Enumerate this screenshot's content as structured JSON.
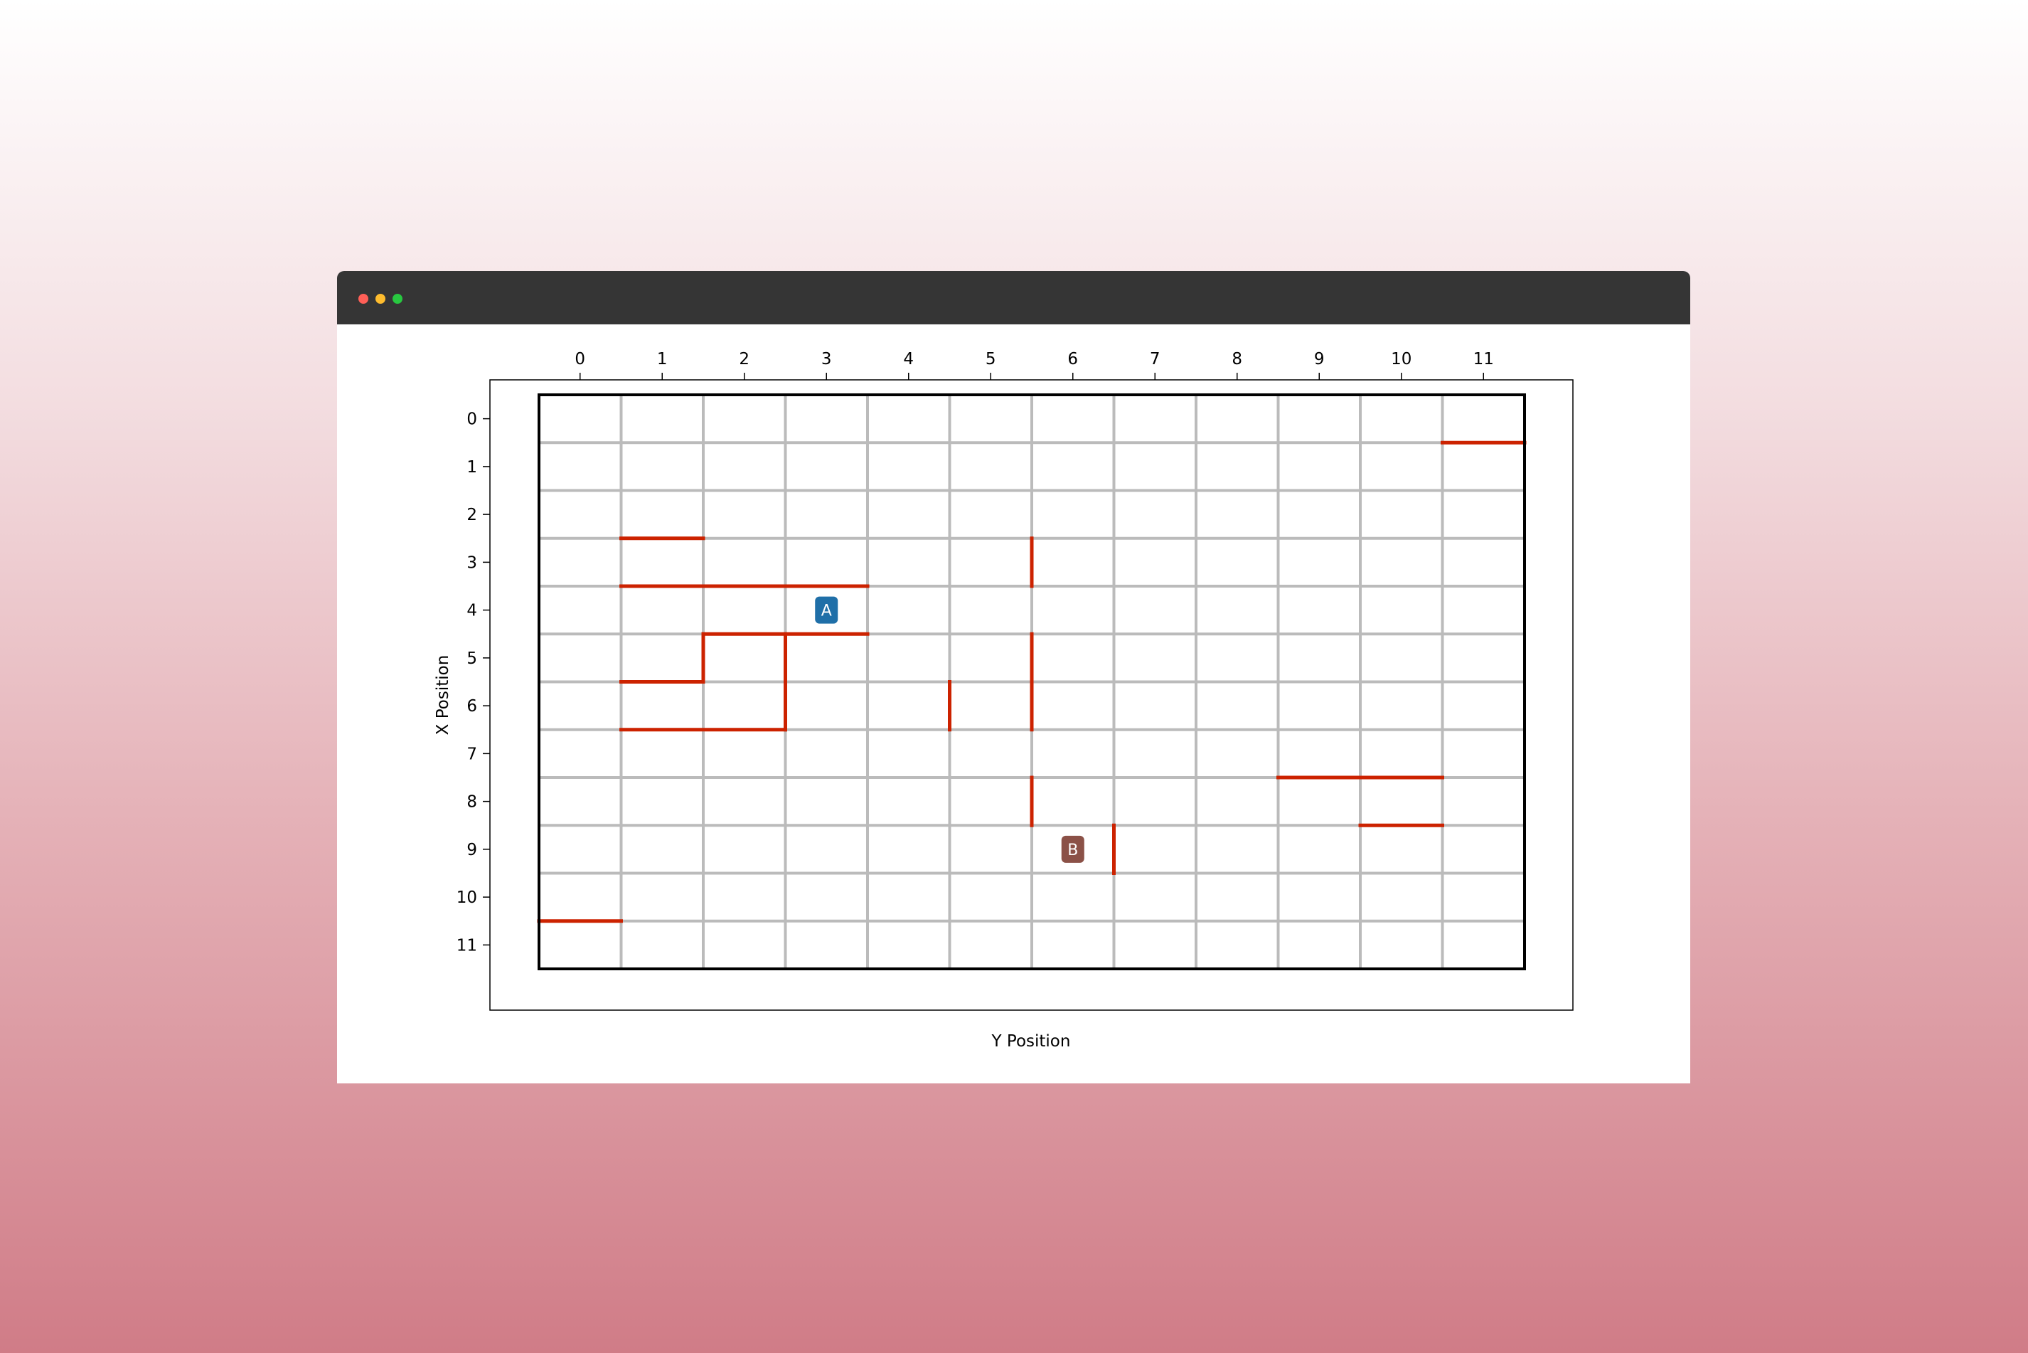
{
  "window": {
    "controls": [
      "close",
      "minimize",
      "maximize"
    ]
  },
  "chart_data": {
    "type": "grid",
    "xlabel": "Y Position",
    "ylabel": "X Position",
    "x_ticks": [
      0,
      1,
      2,
      3,
      4,
      5,
      6,
      7,
      8,
      9,
      10,
      11
    ],
    "y_ticks": [
      0,
      1,
      2,
      3,
      4,
      5,
      6,
      7,
      8,
      9,
      10,
      11
    ],
    "grid": true,
    "x_axis_position": "top",
    "y_axis_inverted": true,
    "colors": {
      "wall": "#cc2200",
      "grid": "#bbbbbb",
      "border": "#000000",
      "agent_a": "#1f6fa8",
      "agent_b": "#8b5147"
    },
    "walls": [
      {
        "orient": "h",
        "row_edge": 0.5,
        "col_start": 10.5,
        "col_end": 11.5
      },
      {
        "orient": "h",
        "row_edge": 2.5,
        "col_start": 0.5,
        "col_end": 1.5
      },
      {
        "orient": "h",
        "row_edge": 3.5,
        "col_start": 0.5,
        "col_end": 3.5
      },
      {
        "orient": "h",
        "row_edge": 4.5,
        "col_start": 1.5,
        "col_end": 3.5
      },
      {
        "orient": "h",
        "row_edge": 5.5,
        "col_start": 0.5,
        "col_end": 1.5
      },
      {
        "orient": "h",
        "row_edge": 6.5,
        "col_start": 0.5,
        "col_end": 2.5
      },
      {
        "orient": "h",
        "row_edge": 7.5,
        "col_start": 8.5,
        "col_end": 10.5
      },
      {
        "orient": "h",
        "row_edge": 8.5,
        "col_start": 9.5,
        "col_end": 10.5
      },
      {
        "orient": "h",
        "row_edge": 10.5,
        "col_start": -0.5,
        "col_end": 0.5
      },
      {
        "orient": "v",
        "col_edge": 5.5,
        "row_start": 2.5,
        "row_end": 3.5
      },
      {
        "orient": "v",
        "col_edge": 1.5,
        "row_start": 4.5,
        "row_end": 5.5
      },
      {
        "orient": "v",
        "col_edge": 2.5,
        "row_start": 4.5,
        "row_end": 6.5
      },
      {
        "orient": "v",
        "col_edge": 5.5,
        "row_start": 4.5,
        "row_end": 6.5
      },
      {
        "orient": "v",
        "col_edge": 4.5,
        "row_start": 5.5,
        "row_end": 6.5
      },
      {
        "orient": "v",
        "col_edge": 5.5,
        "row_start": 7.5,
        "row_end": 8.5
      },
      {
        "orient": "v",
        "col_edge": 6.5,
        "row_start": 8.5,
        "row_end": 9.5
      }
    ],
    "agents": [
      {
        "label": "A",
        "x": 4,
        "y": 3,
        "color": "#1f6fa8"
      },
      {
        "label": "B",
        "x": 9,
        "y": 6,
        "color": "#8b5147"
      }
    ]
  }
}
